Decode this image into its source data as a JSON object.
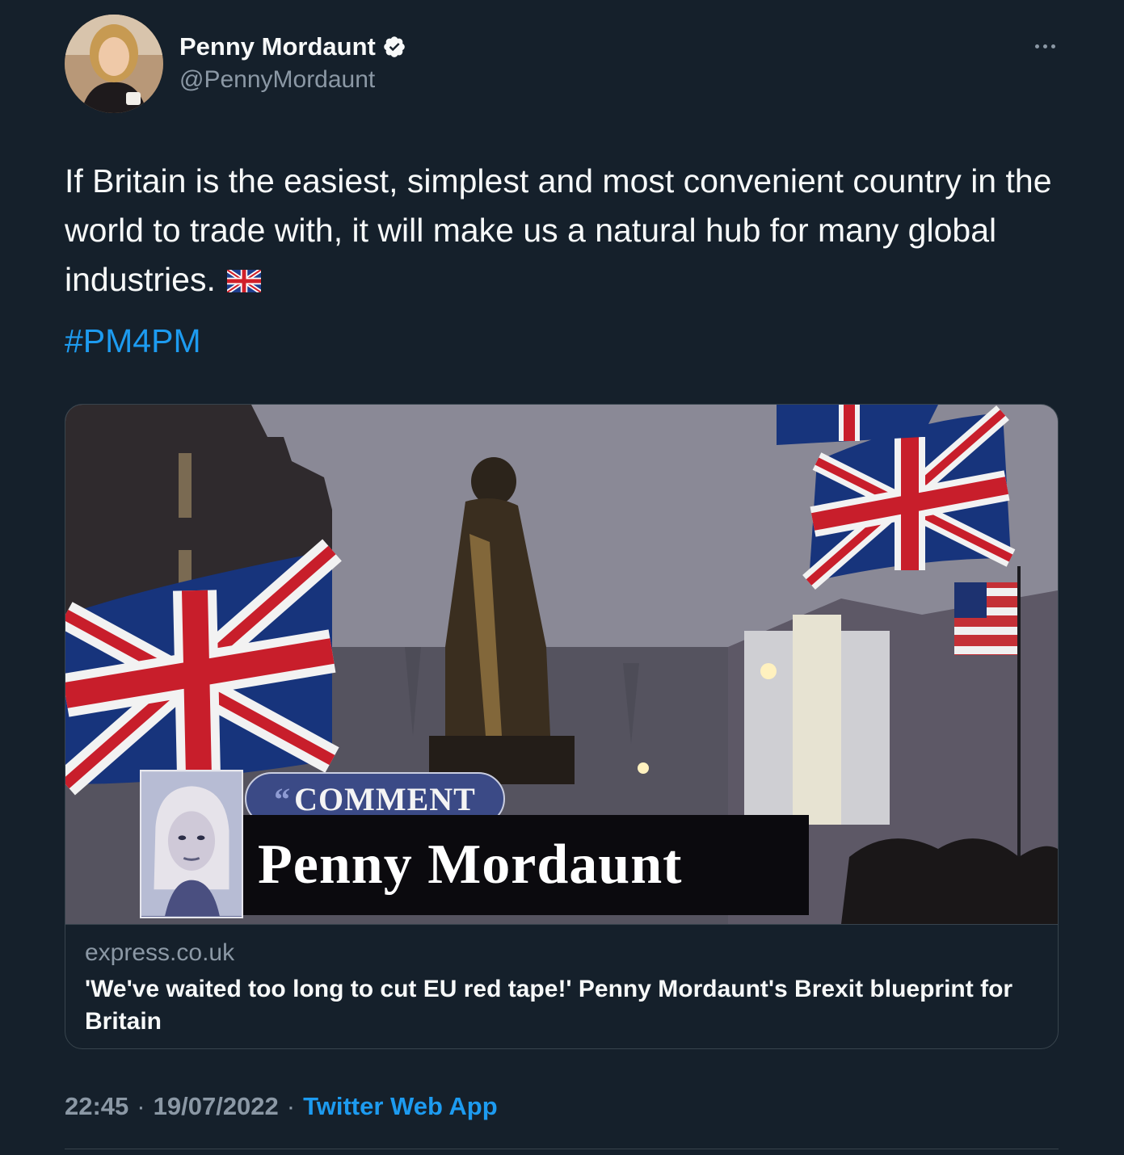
{
  "author": {
    "display_name": "Penny Mordaunt",
    "handle": "@PennyMordaunt",
    "verified": true
  },
  "tweet": {
    "text": "If Britain is the easiest, simplest and most convenient country in the world to trade with, it will make us a natural hub for many global industries.",
    "emoji": "uk-flag",
    "hashtag": "#PM4PM"
  },
  "card": {
    "image": {
      "label_tag": "COMMENT",
      "label_name": "Penny Mordaunt"
    },
    "domain": "express.co.uk",
    "title": "'We've waited too long to cut EU red tape!' Penny Mordaunt's Brexit blueprint for Britain"
  },
  "meta": {
    "time": "22:45",
    "separator": "·",
    "date": "19/07/2022",
    "source": "Twitter Web App"
  },
  "colors": {
    "background": "#15202b",
    "text_primary": "#f7f9f9",
    "text_secondary": "#8b98a5",
    "accent": "#1d9bf0",
    "border": "#38444d"
  },
  "icons": {
    "more": "more-horizontal-icon",
    "verified": "verified-badge-icon"
  }
}
